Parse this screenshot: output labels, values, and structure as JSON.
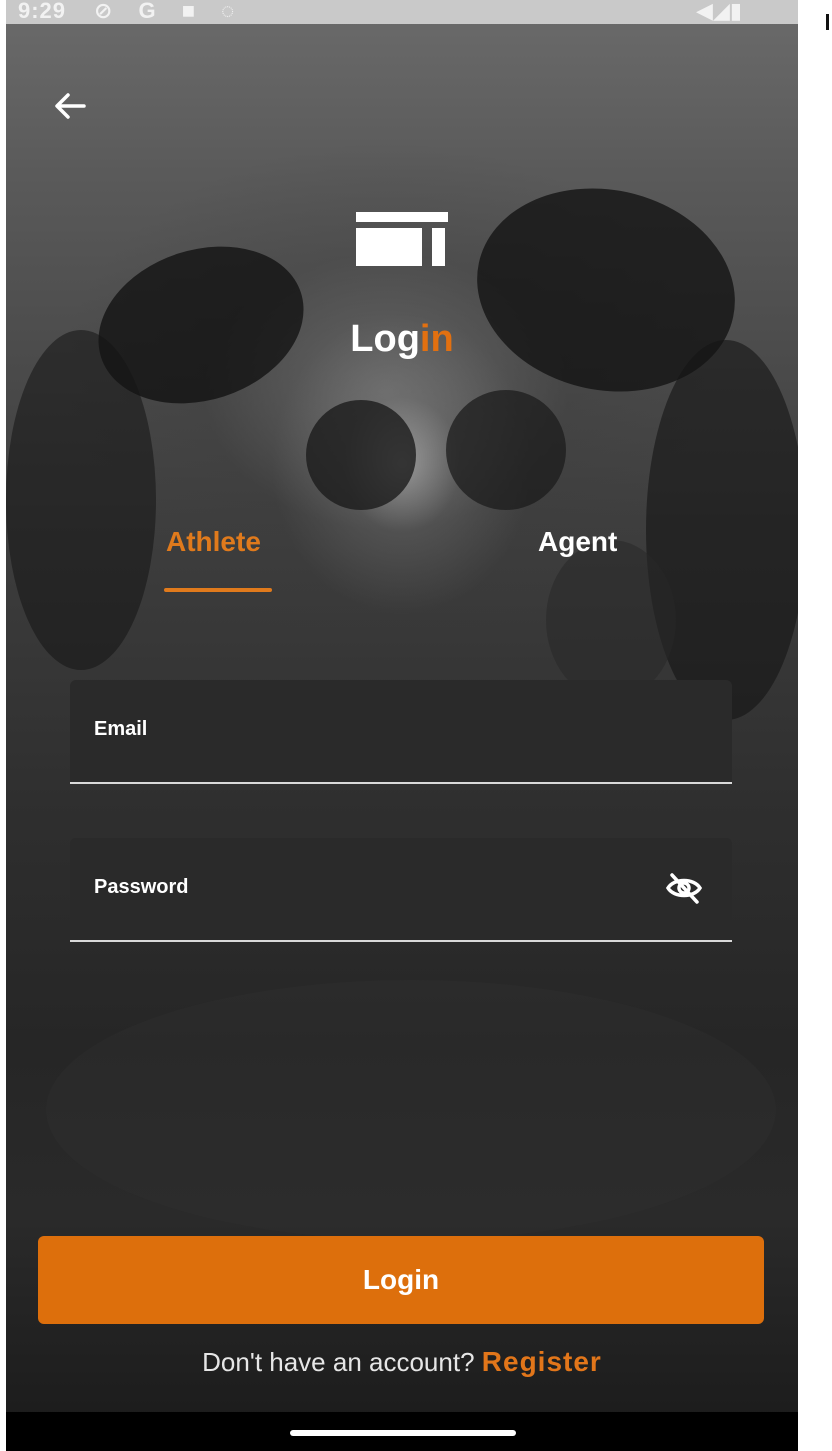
{
  "status_bar": {
    "time": "9:29",
    "left_icons": [
      "do-not-disturb-icon",
      "google-icon",
      "square-notification-icon",
      "alarm-icon"
    ],
    "left_icons_text": "⊘ G ■ ◌",
    "right_icons": [
      "wifi-icon",
      "signal-icon",
      "battery-icon"
    ],
    "right_icons_text": "◀◢▮"
  },
  "header": {
    "back_icon": "arrow-left-icon",
    "logo_icon": "app-logo-icon"
  },
  "title": {
    "part1": "Log",
    "part2": "in"
  },
  "tabs": [
    {
      "label": "Athlete",
      "selected": true
    },
    {
      "label": "Agent",
      "selected": false
    }
  ],
  "form": {
    "email": {
      "label": "Email",
      "value": ""
    },
    "password": {
      "label": "Password",
      "value": "",
      "toggle_icon": "eye-off-icon"
    }
  },
  "login_button": {
    "label": "Login"
  },
  "register": {
    "prompt": "Don't have an account?",
    "link": "Register"
  },
  "colors": {
    "accent": "#dd6f0c",
    "field_bg": "#2a2a2a",
    "text": "#ffffff"
  }
}
